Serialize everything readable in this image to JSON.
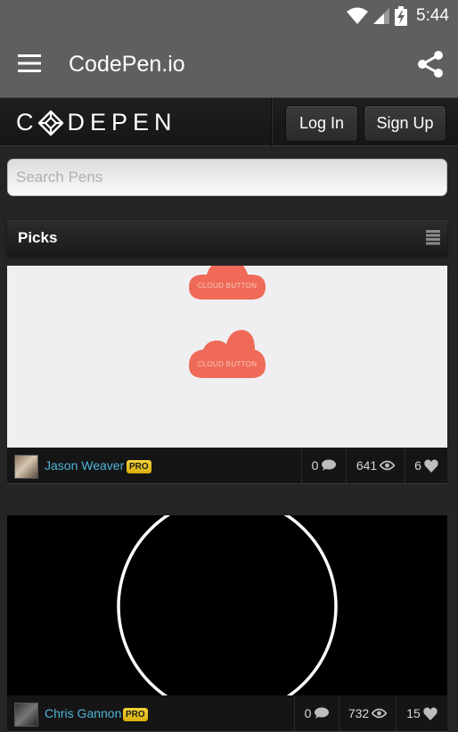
{
  "status_bar": {
    "time": "5:44",
    "icons": [
      "wifi-icon",
      "signal-icon",
      "battery-charging-icon"
    ]
  },
  "app_bar": {
    "title": "CodePen.io",
    "menu_icon": "hamburger-menu-icon",
    "share_icon": "share-icon"
  },
  "header": {
    "logo_text_left": "C",
    "logo_text_right": "DEPEN",
    "login_label": "Log In",
    "signup_label": "Sign Up"
  },
  "search": {
    "placeholder": "Search Pens",
    "value": ""
  },
  "section": {
    "title": "Picks",
    "menu_icon": "list-icon"
  },
  "pens": [
    {
      "preview": {
        "background": "#efeff1",
        "button_color": "#ef6a58",
        "buttons": [
          "CLOUD BUTTON",
          "CLOUD BUTTON"
        ]
      },
      "author": "Jason Weaver",
      "badge": "PRO",
      "comments": "0",
      "views": "641",
      "likes": "6"
    },
    {
      "preview": {
        "background": "#000000",
        "shape": "circle-outline"
      },
      "author": "Chris Gannon",
      "badge": "PRO",
      "comments": "0",
      "views": "732",
      "likes": "15"
    }
  ],
  "colors": {
    "app_bar": "#5f5f5f",
    "page_bg": "#252526",
    "author_link": "#4fb4d8",
    "pro_badge": "#f0cc2a"
  }
}
